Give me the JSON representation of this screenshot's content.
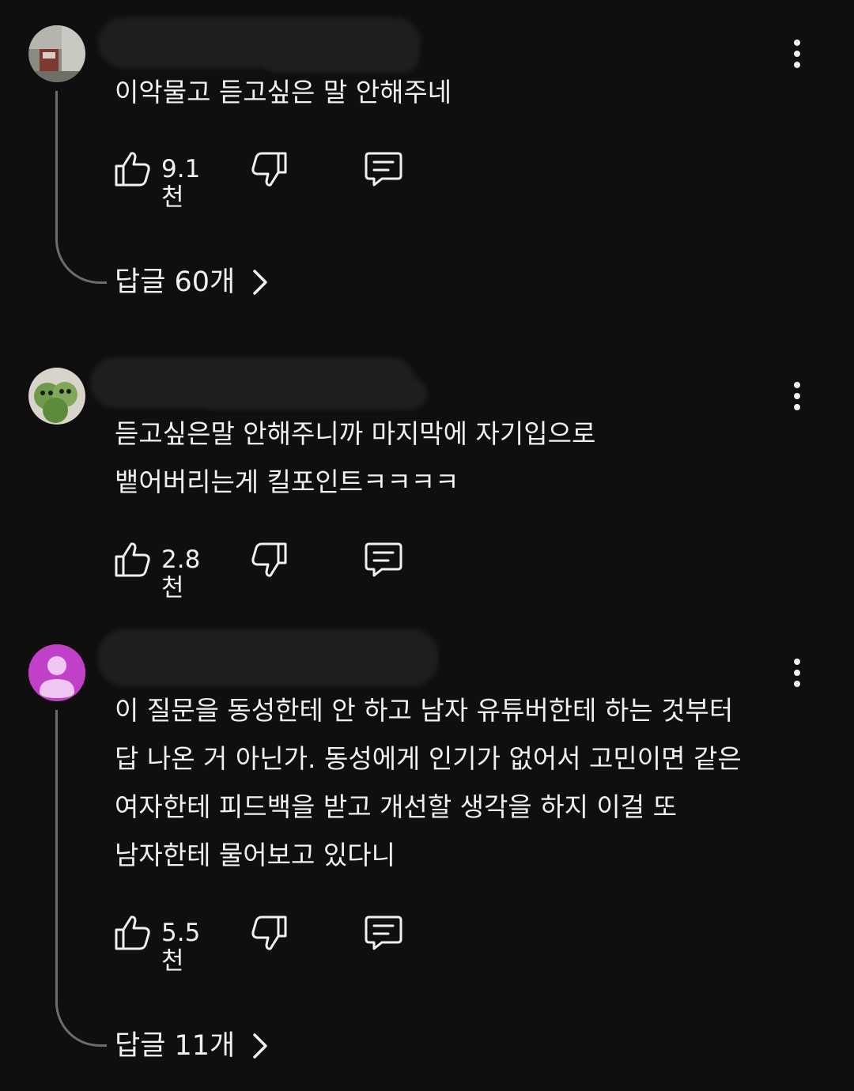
{
  "comments": [
    {
      "text": "이악물고 듣고싶은 말 안해주네",
      "like_count": "9.1천",
      "replies_label": "답글 60개",
      "avatar_icon": "photo-avatar-icon"
    },
    {
      "text": "듣고싶은말 안해주니까 마지막에 자기입으로\n뱉어버리는게 킬포인트ㅋㅋㅋㅋ",
      "like_count": "2.8천",
      "avatar_icon": "photo-avatar-icon"
    },
    {
      "text": "이 질문을 동성한테 안 하고 남자 유튜버한테 하는 것부터\n답 나온 거 아닌가. 동성에게 인기가 없어서 고민이면 같은\n여자한테 피드백을 받고 개선할 생각을 하지 이걸 또\n남자한테 물어보고 있다니",
      "like_count": "5.5천",
      "replies_label": "답글 11개",
      "avatar_icon": "default-user-icon"
    }
  ],
  "icons": {
    "like": "thumbs-up-icon",
    "dislike": "thumbs-down-icon",
    "reply": "reply-comment-icon",
    "menu": "more-vertical-icon",
    "replies_arrow": "chevron-right-icon"
  },
  "colors": {
    "background": "#0f0f0f",
    "text": "#f1f1f1",
    "thread_line": "#6d6d6d",
    "default_avatar_bg": "#c040c8"
  }
}
